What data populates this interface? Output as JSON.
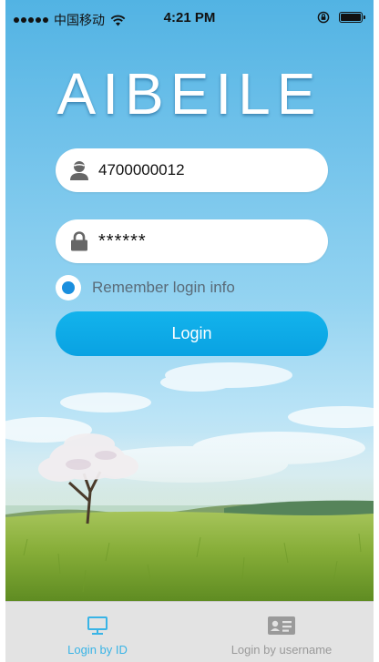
{
  "status_bar": {
    "carrier": "中国移动",
    "time": "4:21 PM",
    "icons": [
      "signal-dots-icon",
      "wifi-icon",
      "orientation-lock-icon",
      "battery-icon"
    ]
  },
  "app": {
    "title": "AIBEILE"
  },
  "login_form": {
    "id_value": "4700000012",
    "password_value": "******",
    "id_icon": "user-icon",
    "password_icon": "lock-icon",
    "remember_label": "Remember login info",
    "remember_checked": true,
    "login_label": "Login"
  },
  "tab_bar": {
    "tabs": [
      {
        "label": "Login by ID",
        "icon": "monitor-icon",
        "active": true
      },
      {
        "label": "Login by username",
        "icon": "id-card-icon",
        "active": false
      }
    ]
  },
  "colors": {
    "accent": "#0aa5e4",
    "active_tab": "#39b4e6",
    "radio_dot": "#1a8fde"
  }
}
